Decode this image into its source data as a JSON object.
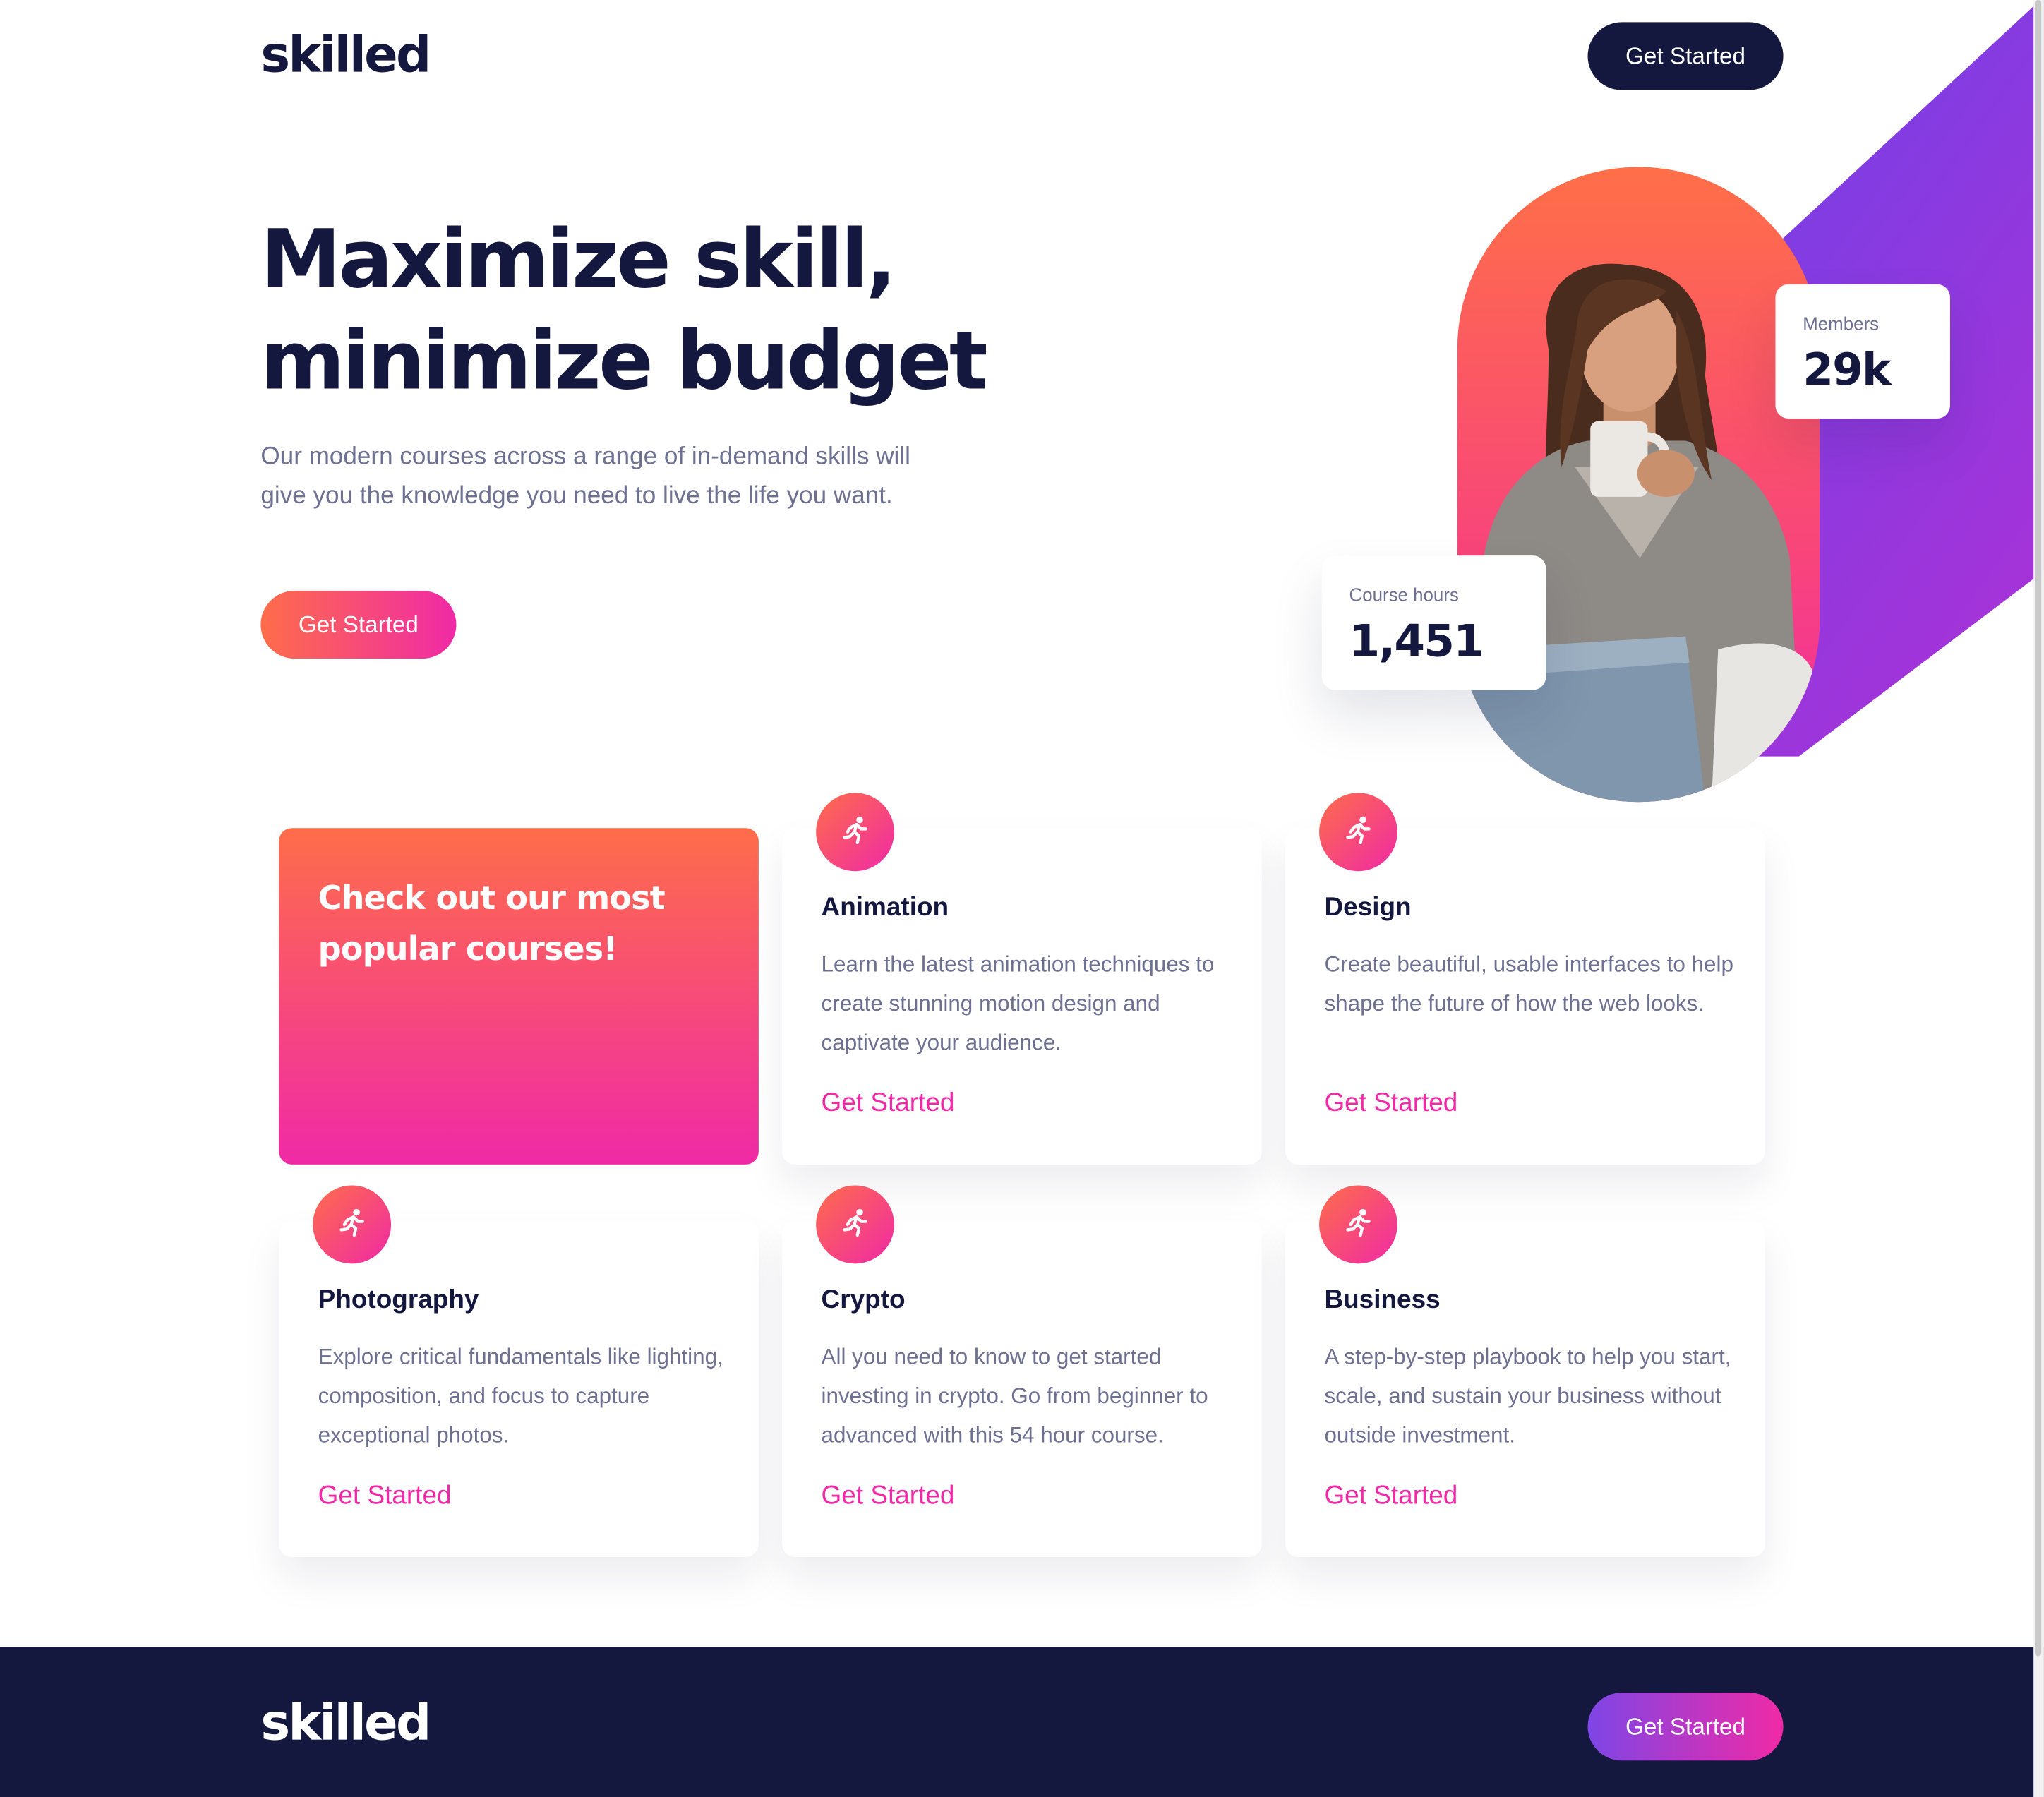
{
  "brand": {
    "logo": "skilled"
  },
  "header": {
    "cta_label": "Get Started"
  },
  "hero": {
    "title_line1": "Maximize skill,",
    "title_line2": "minimize budget",
    "description": "Our modern courses across a range of in-demand skills will give you the knowledge you need to live the life you want.",
    "cta_label": "Get Started"
  },
  "stats": {
    "members": {
      "label": "Members",
      "value": "29k"
    },
    "course_hours": {
      "label": "Course hours",
      "value": "1,451"
    }
  },
  "courses": {
    "promo_heading": "Check out our most popular courses!",
    "items": [
      {
        "title": "Animation",
        "description": "Learn the latest animation techniques to create stunning motion design and captivate your audience.",
        "link": "Get Started",
        "icon": "running-person-icon"
      },
      {
        "title": "Design",
        "description": "Create beautiful, usable interfaces to help shape the future of how the web looks.",
        "link": "Get Started",
        "icon": "running-person-icon"
      },
      {
        "title": "Photography",
        "description": "Explore critical fundamentals like lighting, composition, and focus to capture exceptional photos.",
        "link": "Get Started",
        "icon": "running-person-icon"
      },
      {
        "title": "Crypto",
        "description": "All you need to know to get started investing in crypto. Go from beginner to advanced with this 54 hour course.",
        "link": "Get Started",
        "icon": "running-person-icon"
      },
      {
        "title": "Business",
        "description": "A step-by-step playbook to help you start, scale, and sustain your business without outside investment.",
        "link": "Get Started",
        "icon": "running-person-icon"
      }
    ]
  },
  "footer": {
    "logo": "skilled",
    "cta_label": "Get Started"
  },
  "colors": {
    "navy": "#14183e",
    "orange": "#fe6d4a",
    "pink": "#f02aa6",
    "purple": "#7e46e6",
    "gray_text": "#6d7091"
  }
}
